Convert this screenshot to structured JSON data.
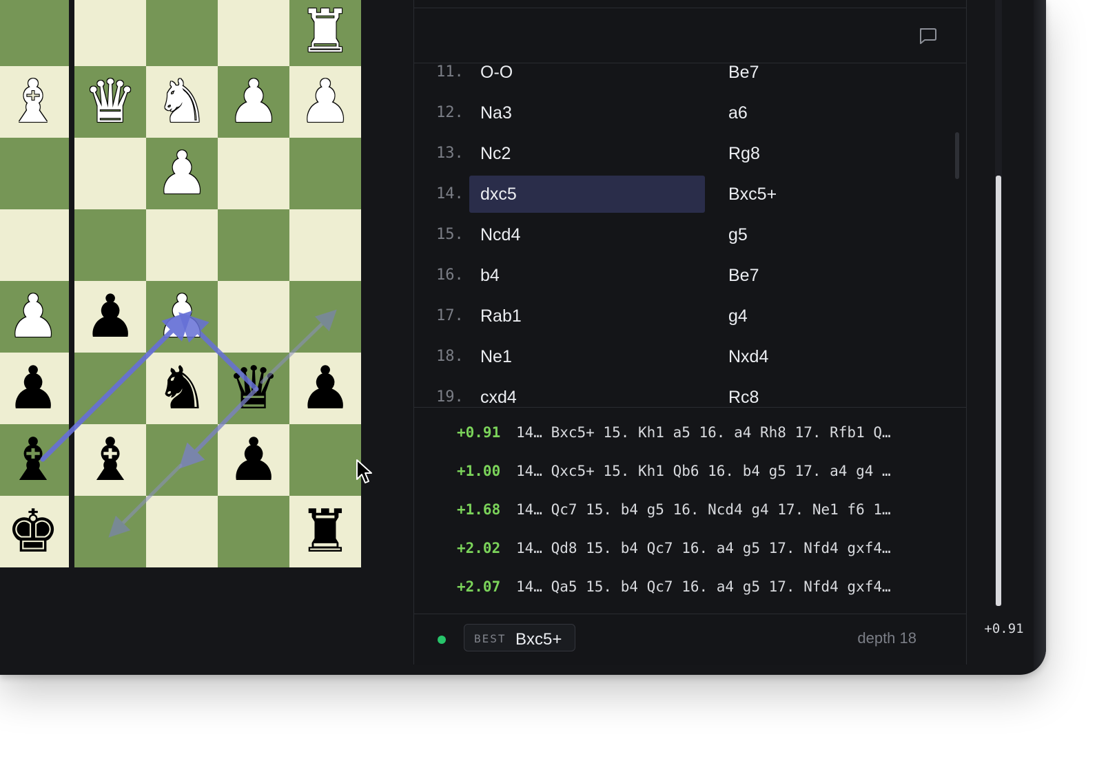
{
  "panel": {
    "comment_icon": "comment-bubble-icon"
  },
  "board": {
    "colors": {
      "light": "#eeeed2",
      "dark": "#769656",
      "arrow": "#6670d6"
    },
    "squares": [
      [
        "a8",
        "dark"
      ],
      [
        "b8",
        "light"
      ],
      [
        "c8",
        "dark"
      ],
      [
        "d8",
        "light"
      ],
      [
        "e8",
        "dark"
      ]
    ],
    "pieces": [
      {
        "name": "white-rook-icon",
        "glyph": "♜",
        "color": "w"
      },
      {
        "name": "white-bishop-icon",
        "glyph": "♝",
        "color": "w"
      },
      {
        "name": "white-queen-icon",
        "glyph": "♛",
        "color": "w"
      },
      {
        "name": "white-knight-icon",
        "glyph": "♞",
        "color": "w"
      },
      {
        "name": "white-pawn-icon",
        "glyph": "♟",
        "color": "w"
      },
      {
        "name": "white-pawn-icon",
        "glyph": "♟",
        "color": "w"
      },
      {
        "name": "white-pawn-icon",
        "glyph": "♟",
        "color": "w"
      },
      {
        "name": "white-pawn-icon",
        "glyph": "♟",
        "color": "w"
      },
      {
        "name": "black-pawn-icon",
        "glyph": "♟",
        "color": "b"
      },
      {
        "name": "white-pawn-icon",
        "glyph": "♟",
        "color": "w"
      },
      {
        "name": "black-pawn-icon",
        "glyph": "♟",
        "color": "b"
      },
      {
        "name": "black-knight-icon",
        "glyph": "♞",
        "color": "b"
      },
      {
        "name": "black-queen-icon",
        "glyph": "♛",
        "color": "b"
      },
      {
        "name": "black-pawn-icon",
        "glyph": "♟",
        "color": "b"
      },
      {
        "name": "black-bishop-icon",
        "glyph": "♝",
        "color": "b"
      },
      {
        "name": "black-bishop-icon",
        "glyph": "♝",
        "color": "b"
      },
      {
        "name": "black-pawn-icon",
        "glyph": "♟",
        "color": "b"
      },
      {
        "name": "black-king-icon",
        "glyph": "♚",
        "color": "b"
      },
      {
        "name": "black-rook-icon",
        "glyph": "♜",
        "color": "b"
      }
    ]
  },
  "moves": [
    {
      "num": "11.",
      "white": "O-O",
      "black": "Be7"
    },
    {
      "num": "12.",
      "white": "Na3",
      "black": "a6"
    },
    {
      "num": "13.",
      "white": "Nc2",
      "black": "Rg8"
    },
    {
      "num": "14.",
      "white": "dxc5",
      "black": "Bxc5+"
    },
    {
      "num": "15.",
      "white": "Ncd4",
      "black": "g5"
    },
    {
      "num": "16.",
      "white": "b4",
      "black": "Be7"
    },
    {
      "num": "17.",
      "white": "Rab1",
      "black": "g4"
    },
    {
      "num": "18.",
      "white": "Ne1",
      "black": "Nxd4"
    },
    {
      "num": "19.",
      "white": "cxd4",
      "black": "Rc8"
    }
  ],
  "engine_lines": [
    {
      "eval": "+0.91",
      "pv": "14… Bxc5+ 15. Kh1 a5 16. a4 Rh8 17. Rfb1 Q…"
    },
    {
      "eval": "+1.00",
      "pv": "14… Qxc5+ 15. Kh1 Qb6 16. b4 g5 17. a4 g4 …"
    },
    {
      "eval": "+1.68",
      "pv": "14… Qc7 15. b4 g5 16. Ncd4 g4 17. Ne1 f6 1…"
    },
    {
      "eval": "+2.02",
      "pv": "14… Qd8 15. b4 Qc7 16. a4 g5 17. Nfd4 gxf4…"
    },
    {
      "eval": "+2.07",
      "pv": "14… Qa5 15. b4 Qc7 16. a4 g5 17. Nfd4 gxf4…"
    }
  ],
  "status": {
    "best_label": "BEST",
    "best_move": "Bxc5+",
    "depth": "depth 18",
    "indicator_color": "#27c46a"
  },
  "eval_bar": {
    "value": "+0.91",
    "white_fraction": 0.71
  }
}
